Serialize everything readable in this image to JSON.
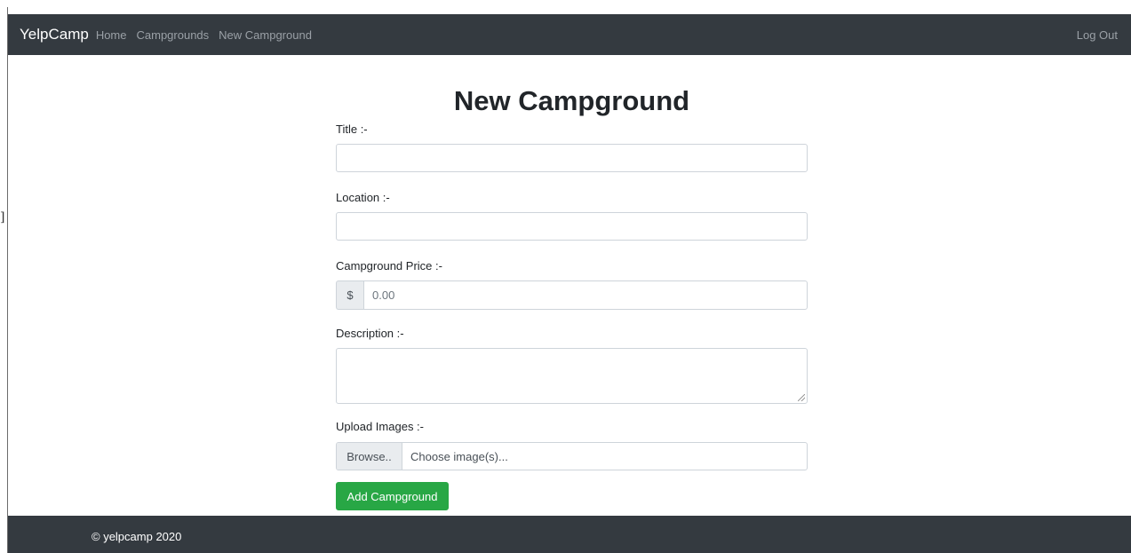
{
  "navbar": {
    "brand": "YelpCamp",
    "links": [
      "Home",
      "Campgrounds",
      "New Campground"
    ],
    "logout": "Log Out"
  },
  "page": {
    "title": "New Campground"
  },
  "form": {
    "title_label": "Title :-",
    "title_value": "",
    "location_label": "Location :-",
    "location_value": "",
    "price_label": "Campground Price :-",
    "price_addon": "$",
    "price_placeholder": "0.00",
    "description_label": "Description :-",
    "description_value": "",
    "images_label": "Upload Images :-",
    "browse_label": "Browse..",
    "file_placeholder": "Choose image(s)...",
    "submit_label": "Add Campground"
  },
  "footer": {
    "text": "© yelpcamp 2020"
  },
  "colors": {
    "navbar": "#343a40",
    "submit": "#28a745"
  }
}
